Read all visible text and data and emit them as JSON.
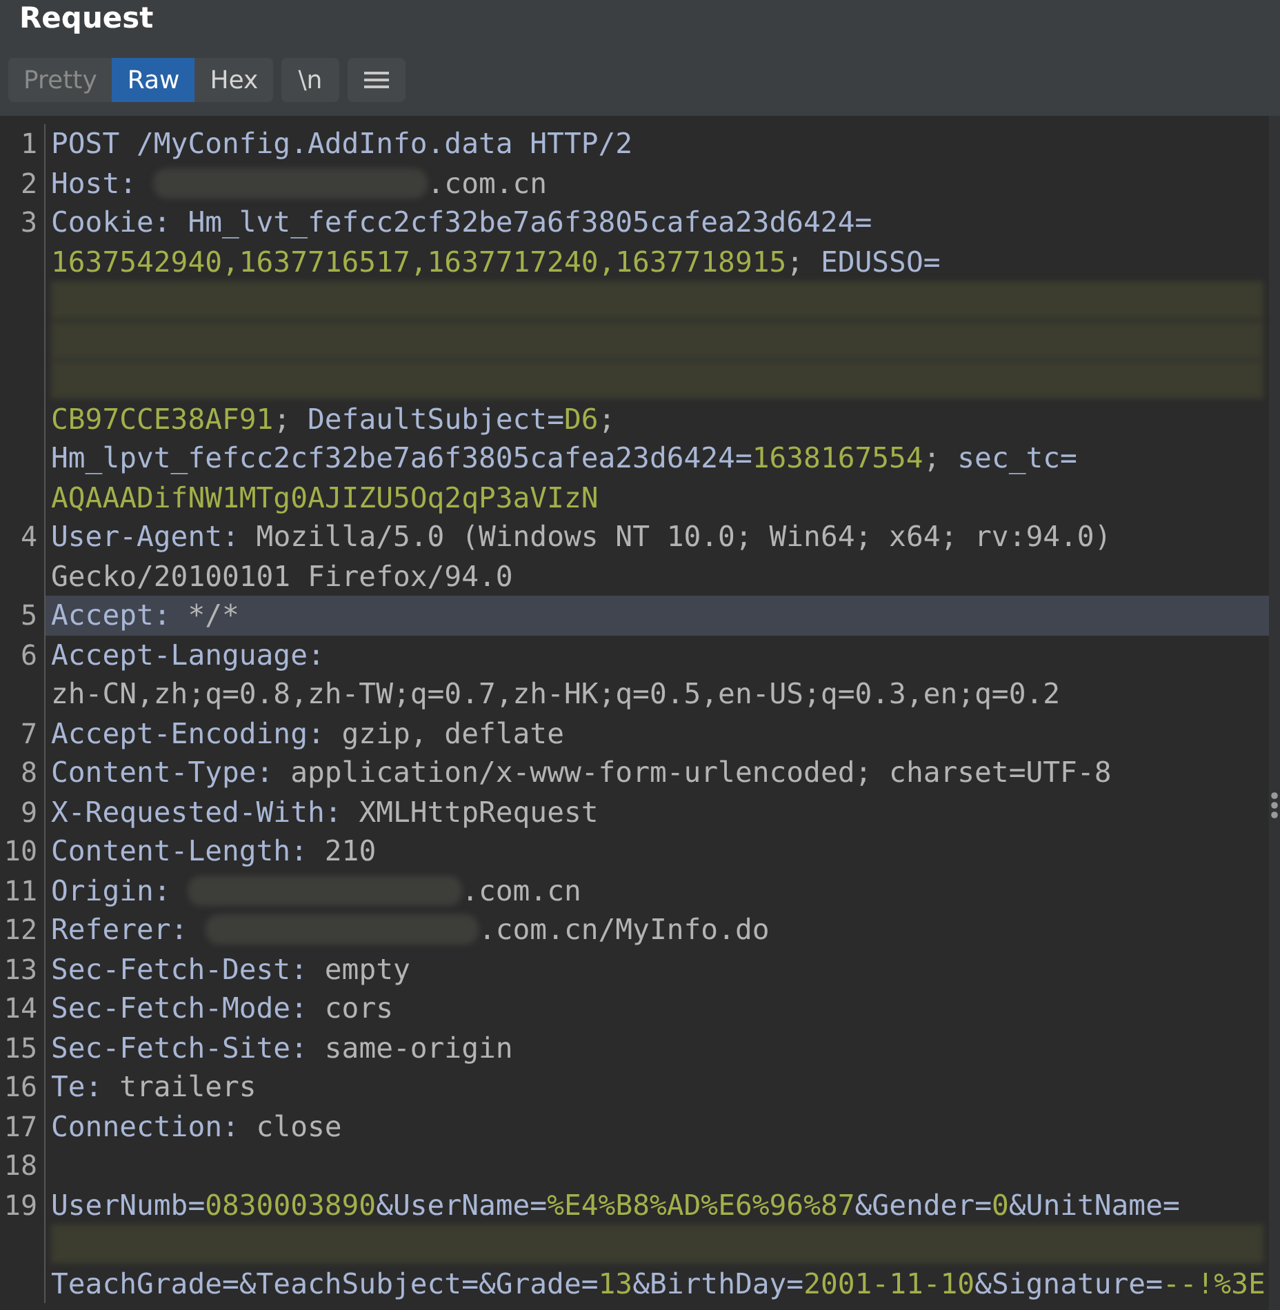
{
  "title": "Request",
  "view_tabs": [
    {
      "label": "Pretty",
      "selected": false,
      "disabled": true
    },
    {
      "label": "Raw",
      "selected": true,
      "disabled": false
    },
    {
      "label": "Hex",
      "selected": false,
      "disabled": false
    }
  ],
  "newline_toggle": {
    "label": "\\n"
  },
  "lines": [
    {
      "number": "1",
      "selected": false,
      "rows": [
        {
          "parts": [
            {
              "kind": "key",
              "text": "POST /MyConfig.AddInfo.data HTTP/2"
            }
          ]
        }
      ]
    },
    {
      "number": "2",
      "selected": false,
      "rows": [
        {
          "parts": [
            {
              "kind": "key",
              "text": "Host: "
            },
            {
              "kind": "redacted"
            },
            {
              "kind": "val",
              "text": ".com.cn"
            }
          ]
        }
      ]
    },
    {
      "number": "3",
      "selected": false,
      "rows": [
        {
          "parts": [
            {
              "kind": "key",
              "text": "Cookie: Hm_lvt_fefcc2cf32be7a6f3805cafea23d6424="
            }
          ]
        },
        {
          "parts": [
            {
              "kind": "str",
              "text": "1637542940,1637716517,1637717240,1637718915"
            },
            {
              "kind": "val",
              "text": "; "
            },
            {
              "kind": "key",
              "text": "EDUSSO="
            }
          ]
        },
        {
          "parts": [
            {
              "kind": "redacted-row"
            }
          ]
        },
        {
          "parts": [
            {
              "kind": "redacted-row"
            }
          ]
        },
        {
          "parts": [
            {
              "kind": "redacted-row"
            }
          ]
        },
        {
          "parts": [
            {
              "kind": "str",
              "text": "CB97CCE38AF91"
            },
            {
              "kind": "val",
              "text": "; "
            },
            {
              "kind": "key",
              "text": "DefaultSubject="
            },
            {
              "kind": "str",
              "text": "D6"
            },
            {
              "kind": "val",
              "text": ";"
            }
          ]
        },
        {
          "parts": [
            {
              "kind": "key",
              "text": "Hm_lpvt_fefcc2cf32be7a6f3805cafea23d6424="
            },
            {
              "kind": "str",
              "text": "1638167554"
            },
            {
              "kind": "val",
              "text": "; "
            },
            {
              "kind": "key",
              "text": "sec_tc="
            }
          ]
        },
        {
          "parts": [
            {
              "kind": "str",
              "text": "AQAAADifNW1MTg0AJIZU5Oq2qP3aVIzN"
            }
          ]
        }
      ]
    },
    {
      "number": "4",
      "selected": false,
      "rows": [
        {
          "parts": [
            {
              "kind": "key",
              "text": "User-Agent: "
            },
            {
              "kind": "val",
              "text": "Mozilla/5.0 (Windows NT 10.0; Win64; x64; rv:94.0)"
            }
          ]
        },
        {
          "parts": [
            {
              "kind": "val",
              "text": "Gecko/20100101 Firefox/94.0"
            }
          ]
        }
      ]
    },
    {
      "number": "5",
      "selected": true,
      "rows": [
        {
          "parts": [
            {
              "kind": "key",
              "text": "Accept: "
            },
            {
              "kind": "val",
              "text": "*/*"
            }
          ]
        }
      ]
    },
    {
      "number": "6",
      "selected": false,
      "rows": [
        {
          "parts": [
            {
              "kind": "key",
              "text": "Accept-Language:"
            }
          ]
        },
        {
          "parts": [
            {
              "kind": "val",
              "text": "zh-CN,zh;q=0.8,zh-TW;q=0.7,zh-HK;q=0.5,en-US;q=0.3,en;q=0.2"
            }
          ]
        }
      ]
    },
    {
      "number": "7",
      "selected": false,
      "rows": [
        {
          "parts": [
            {
              "kind": "key",
              "text": "Accept-Encoding: "
            },
            {
              "kind": "val",
              "text": "gzip, deflate"
            }
          ]
        }
      ]
    },
    {
      "number": "8",
      "selected": false,
      "rows": [
        {
          "parts": [
            {
              "kind": "key",
              "text": "Content-Type: "
            },
            {
              "kind": "val",
              "text": "application/x-www-form-urlencoded; charset=UTF-8"
            }
          ]
        }
      ]
    },
    {
      "number": "9",
      "selected": false,
      "rows": [
        {
          "parts": [
            {
              "kind": "key",
              "text": "X-Requested-With: "
            },
            {
              "kind": "val",
              "text": "XMLHttpRequest"
            }
          ]
        }
      ]
    },
    {
      "number": "10",
      "selected": false,
      "rows": [
        {
          "parts": [
            {
              "kind": "key",
              "text": "Content-Length: "
            },
            {
              "kind": "val",
              "text": "210"
            }
          ]
        }
      ]
    },
    {
      "number": "11",
      "selected": false,
      "rows": [
        {
          "parts": [
            {
              "kind": "key",
              "text": "Origin: "
            },
            {
              "kind": "redacted"
            },
            {
              "kind": "val",
              "text": ".com.cn"
            }
          ]
        }
      ]
    },
    {
      "number": "12",
      "selected": false,
      "rows": [
        {
          "parts": [
            {
              "kind": "key",
              "text": "Referer: "
            },
            {
              "kind": "redacted"
            },
            {
              "kind": "val",
              "text": ".com.cn/MyInfo.do"
            }
          ]
        }
      ]
    },
    {
      "number": "13",
      "selected": false,
      "rows": [
        {
          "parts": [
            {
              "kind": "key",
              "text": "Sec-Fetch-Dest: "
            },
            {
              "kind": "val",
              "text": "empty"
            }
          ]
        }
      ]
    },
    {
      "number": "14",
      "selected": false,
      "rows": [
        {
          "parts": [
            {
              "kind": "key",
              "text": "Sec-Fetch-Mode: "
            },
            {
              "kind": "val",
              "text": "cors"
            }
          ]
        }
      ]
    },
    {
      "number": "15",
      "selected": false,
      "rows": [
        {
          "parts": [
            {
              "kind": "key",
              "text": "Sec-Fetch-Site: "
            },
            {
              "kind": "val",
              "text": "same-origin"
            }
          ]
        }
      ]
    },
    {
      "number": "16",
      "selected": false,
      "rows": [
        {
          "parts": [
            {
              "kind": "key",
              "text": "Te: "
            },
            {
              "kind": "val",
              "text": "trailers"
            }
          ]
        }
      ]
    },
    {
      "number": "17",
      "selected": false,
      "rows": [
        {
          "parts": [
            {
              "kind": "key",
              "text": "Connection: "
            },
            {
              "kind": "val",
              "text": "close"
            }
          ]
        }
      ]
    },
    {
      "number": "18",
      "selected": false,
      "rows": [
        {
          "parts": []
        }
      ]
    },
    {
      "number": "19",
      "selected": false,
      "rows": [
        {
          "parts": [
            {
              "kind": "key",
              "text": "UserNumb="
            },
            {
              "kind": "str",
              "text": "0830003890"
            },
            {
              "kind": "key",
              "text": "&UserName="
            },
            {
              "kind": "str",
              "text": "%E4%B8%AD%E6%96%87"
            },
            {
              "kind": "key",
              "text": "&Gender="
            },
            {
              "kind": "str",
              "text": "0"
            },
            {
              "kind": "key",
              "text": "&UnitName="
            }
          ]
        },
        {
          "parts": [
            {
              "kind": "redacted-row"
            }
          ]
        },
        {
          "parts": [
            {
              "kind": "key",
              "text": "TeachGrade=&TeachSubject=&Grade="
            },
            {
              "kind": "str",
              "text": "13"
            },
            {
              "kind": "key",
              "text": "&BirthDay="
            },
            {
              "kind": "str",
              "text": "2001-11-10"
            },
            {
              "kind": "key",
              "text": "&Signature="
            },
            {
              "kind": "str",
              "text": "--!%3E"
            }
          ]
        }
      ]
    }
  ]
}
